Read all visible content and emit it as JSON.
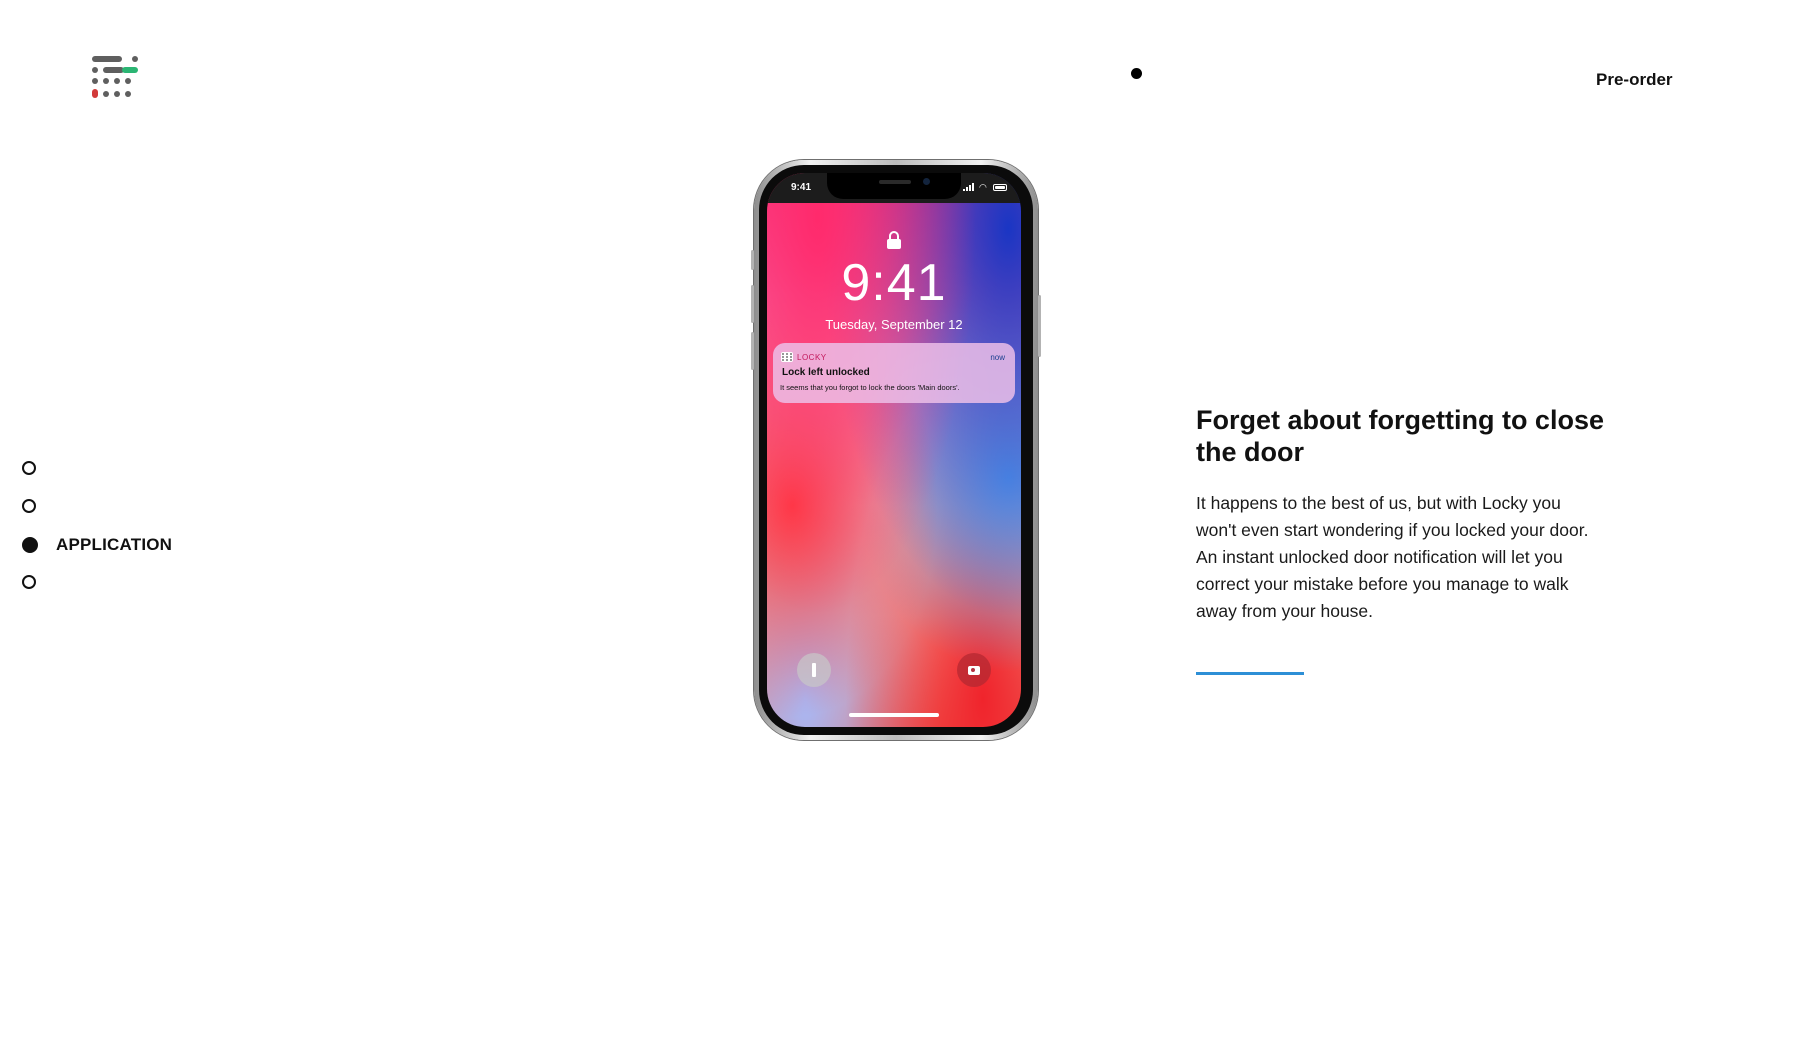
{
  "header": {
    "logo_icon": "dot-grid-logo",
    "cta_label": "Pre-order"
  },
  "section_nav": {
    "items": [
      {
        "label": "",
        "active": false
      },
      {
        "label": "",
        "active": false
      },
      {
        "label": "APPLICATION",
        "active": true
      },
      {
        "label": "",
        "active": false
      }
    ]
  },
  "phone": {
    "status_time": "9:41",
    "lock_time": "9:41",
    "lock_date": "Tuesday, September 12",
    "notification": {
      "app": "LOCKY",
      "time": "now",
      "title": "Lock left unlocked",
      "body": "It seems that you forgot to lock the doors 'Main doors'."
    }
  },
  "feature": {
    "title": "Forget about forgetting to close the door",
    "text": "It happens to the best of us, but with Locky you won't even start wondering if you locked your door. An instant unlocked door notification will let you correct your mistake before you manage to walk away from your house."
  },
  "colors": {
    "accent": "#2d8fd6",
    "logo_green": "#2bb573",
    "logo_red": "#d23a3a",
    "logo_gray": "#5f5f5f"
  }
}
